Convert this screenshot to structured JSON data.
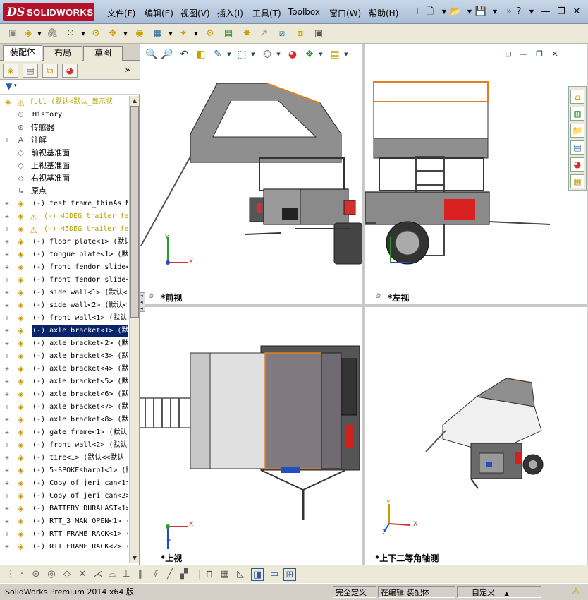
{
  "app": {
    "brand_prefix": "DS",
    "brand": "SOLIDWORKS"
  },
  "menu": {
    "items": [
      "文件(F)",
      "编辑(E)",
      "视图(V)",
      "插入(I)",
      "工具(T)",
      "Toolbox",
      "窗口(W)",
      "帮助(H)"
    ]
  },
  "feature_manager": {
    "tabs": [
      "装配体",
      "布局",
      "草图"
    ],
    "tree": [
      {
        "type": "root",
        "text": "full  (默认<默认_显示状"
      },
      {
        "type": "history",
        "text": "History"
      },
      {
        "type": "sensor",
        "text": "传感器"
      },
      {
        "type": "annotation",
        "text": "注解"
      },
      {
        "type": "plane",
        "text": "前视基准面"
      },
      {
        "type": "plane",
        "text": "上视基准面"
      },
      {
        "type": "plane",
        "text": "右视基准面"
      },
      {
        "type": "origin",
        "text": "原点"
      },
      {
        "type": "part",
        "text": "(-) test frame_thinAs M"
      },
      {
        "type": "part-warn",
        "text": "(-) 45DEG trailer fe"
      },
      {
        "type": "part-warn",
        "text": "(-) 45DEG trailer fe"
      },
      {
        "type": "part",
        "text": "(-) floor plate<1> (默认"
      },
      {
        "type": "part",
        "text": "(-) tongue plate<1> (默"
      },
      {
        "type": "part",
        "text": "(-) front fendor slide<"
      },
      {
        "type": "part",
        "text": "(-) front fendor slide<"
      },
      {
        "type": "part",
        "text": "(-) side wall<1> (默认<"
      },
      {
        "type": "part",
        "text": "(-) side wall<2> (默认<"
      },
      {
        "type": "part",
        "text": "(-) front wall<1> (默认"
      },
      {
        "type": "part-selected",
        "text": "(-) axle bracket<1> (默"
      },
      {
        "type": "part",
        "text": "(-) axle bracket<2> (默"
      },
      {
        "type": "part",
        "text": "(-) axle bracket<3> (默"
      },
      {
        "type": "part",
        "text": "(-) axle bracket<4> (默"
      },
      {
        "type": "part",
        "text": "(-) axle bracket<5> (默"
      },
      {
        "type": "part",
        "text": "(-) axle bracket<6> (默"
      },
      {
        "type": "part",
        "text": "(-) axle bracket<7> (默"
      },
      {
        "type": "part",
        "text": "(-) axle bracket<8> (默"
      },
      {
        "type": "part",
        "text": "(-) gate frame<1> (默认"
      },
      {
        "type": "part",
        "text": "(-) front wall<2> (默认"
      },
      {
        "type": "part",
        "text": "(-) tire<1> (默认<<默认"
      },
      {
        "type": "part",
        "text": "(-) 5-SPOKEsharp1<1> (默"
      },
      {
        "type": "part",
        "text": "(-) Copy of jeri can<1>"
      },
      {
        "type": "part",
        "text": "(-) Copy of jeri can<2>"
      },
      {
        "type": "part",
        "text": "(-) BATTERY_DURALAST<1>"
      },
      {
        "type": "part",
        "text": "(-) RTT_3 MAN OPEN<1> ("
      },
      {
        "type": "part",
        "text": "(-) RTT FRAME RACK<1> ("
      },
      {
        "type": "part",
        "text": "(-) RTT FRAME RACK<2> ("
      }
    ]
  },
  "viewports": {
    "front": {
      "label": "*前视"
    },
    "left": {
      "label": "*左视"
    },
    "top": {
      "label": "*上视"
    },
    "iso": {
      "label": "*上下二等角轴测"
    }
  },
  "axes": {
    "x": "X",
    "y": "Y",
    "z": "Z"
  },
  "status": {
    "product": "SolidWorks Premium 2014 x64 版",
    "definition": "完全定义",
    "editing": "在编辑 装配体",
    "units": "自定义",
    "units_caret": "▲"
  },
  "colors": {
    "accent_orange": "#e08020",
    "trailer_gray": "#8f8f8f",
    "menu_brand_red": "#b3122b",
    "selection_blue": "#0a246a"
  }
}
